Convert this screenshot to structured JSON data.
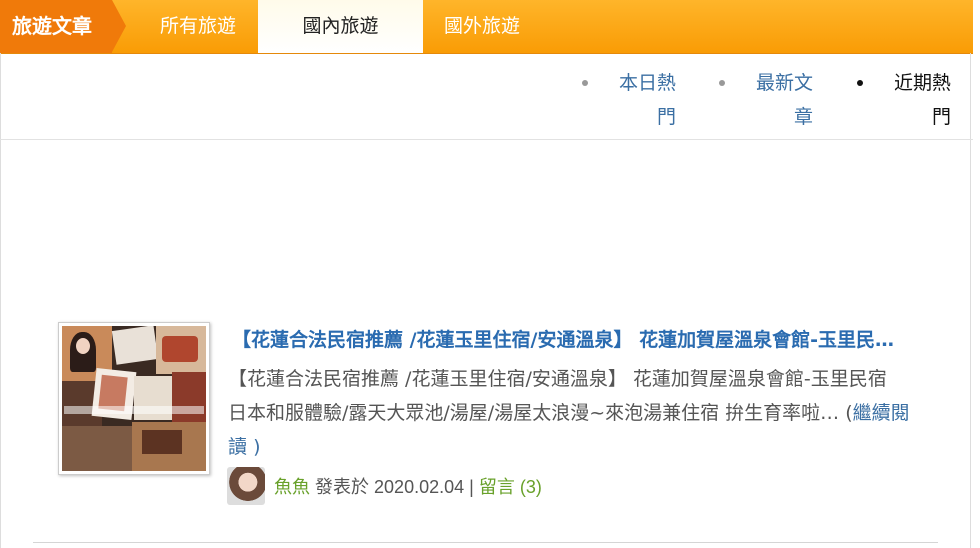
{
  "header": {
    "brand": "旅遊文章",
    "tabs": [
      {
        "label": "所有旅遊",
        "active": false
      },
      {
        "label": "國內旅遊",
        "active": true
      },
      {
        "label": "國外旅遊",
        "active": false
      }
    ]
  },
  "subnav": [
    {
      "line1": "本日熱",
      "line2": "門",
      "active": false
    },
    {
      "line1": "最新文",
      "line2": "章",
      "active": false
    },
    {
      "line1": "近期熱",
      "line2": "門",
      "active": true
    }
  ],
  "post": {
    "title": "【花蓮合法民宿推薦 /花蓮玉里住宿/安通溫泉】 花蓮加賀屋溫泉會館-玉里民宿 日本和服體驗/露天大眾池/湯屋/湯屋太浪漫~來泡湯兼住宿 拚生育率啦",
    "excerpt": "【花蓮合法民宿推薦 /花蓮玉里住宿/安通溫泉】 花蓮加賀屋溫泉會館-玉里民宿　 日本和服體驗/露天大眾池/湯屋/湯屋太浪漫~來泡湯兼住宿 拚生育率啦…",
    "read_more_open": "(",
    "read_more": "繼續閱讀",
    "read_more_close": ")",
    "author": "魚魚",
    "posted_label": "發表於",
    "date": "2020.02.04",
    "separator": "|",
    "comments_label": "留言",
    "comments_count": "(3)"
  },
  "colors": {
    "header_orange": "#f99c05",
    "brand_orange": "#f07a0a",
    "link_blue": "#2a6bb0",
    "author_green": "#69a12b"
  }
}
